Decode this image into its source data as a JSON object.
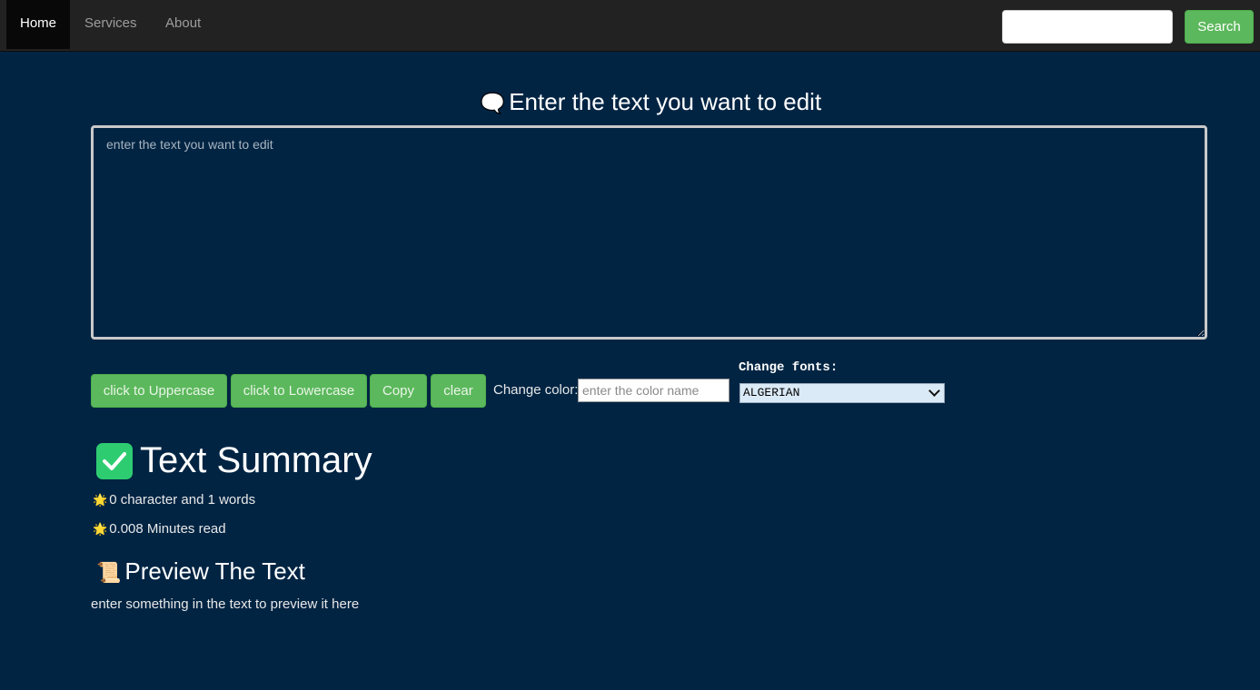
{
  "navbar": {
    "items": [
      {
        "label": "Home"
      },
      {
        "label": "Services"
      },
      {
        "label": "About"
      }
    ],
    "search_placeholder": "",
    "search_button": "Search"
  },
  "editor": {
    "heading": "Enter the text you want to edit",
    "heading_icon": "speech-bubble-icon",
    "placeholder": "enter the text you want to edit",
    "value": ""
  },
  "toolbar": {
    "uppercase_label": "click to Uppercase",
    "lowercase_label": "click to Lowercase",
    "copy_label": "Copy",
    "clear_label": "clear",
    "color_label": "Change color:",
    "color_placeholder": "enter the color name",
    "fonts_label": "Change fonts:",
    "font_selected": "ALGERIAN"
  },
  "summary": {
    "heading": "Text Summary",
    "heading_icon": "check-mark-button-icon",
    "chars_line": "0 character and 1 words",
    "read_line": "0.008 Minutes read",
    "bullet_icon": "sun-icon"
  },
  "preview": {
    "heading": "Preview The Text",
    "heading_icon": "scroll-icon",
    "text": "enter something in the text to preview it here"
  },
  "colors": {
    "page_bg": "#012443",
    "navbar_bg": "#222222",
    "button_green": "#5cb85c"
  }
}
